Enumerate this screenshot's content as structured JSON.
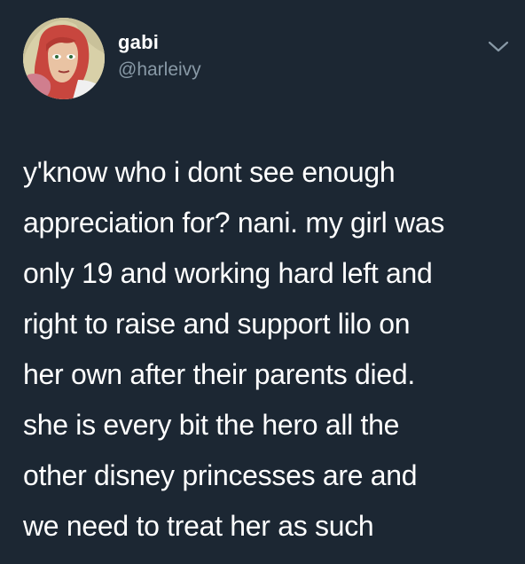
{
  "user": {
    "display_name": "gabi",
    "handle": "@harleivy",
    "avatar_icon": "profile-avatar"
  },
  "menu": {
    "icon": "chevron-down-icon"
  },
  "tweet": {
    "lines": [
      "y'know who i dont see enough",
      "appreciation for? nani. my girl was",
      "only 19 and working hard left and",
      "right to raise and support lilo on",
      "her own after their parents died.",
      "she is every bit the hero all the",
      "other disney princesses are and",
      "we need to treat her as such"
    ]
  },
  "colors": {
    "background": "#1c2733",
    "text": "#ffffff",
    "secondary_text": "#8899a6"
  }
}
